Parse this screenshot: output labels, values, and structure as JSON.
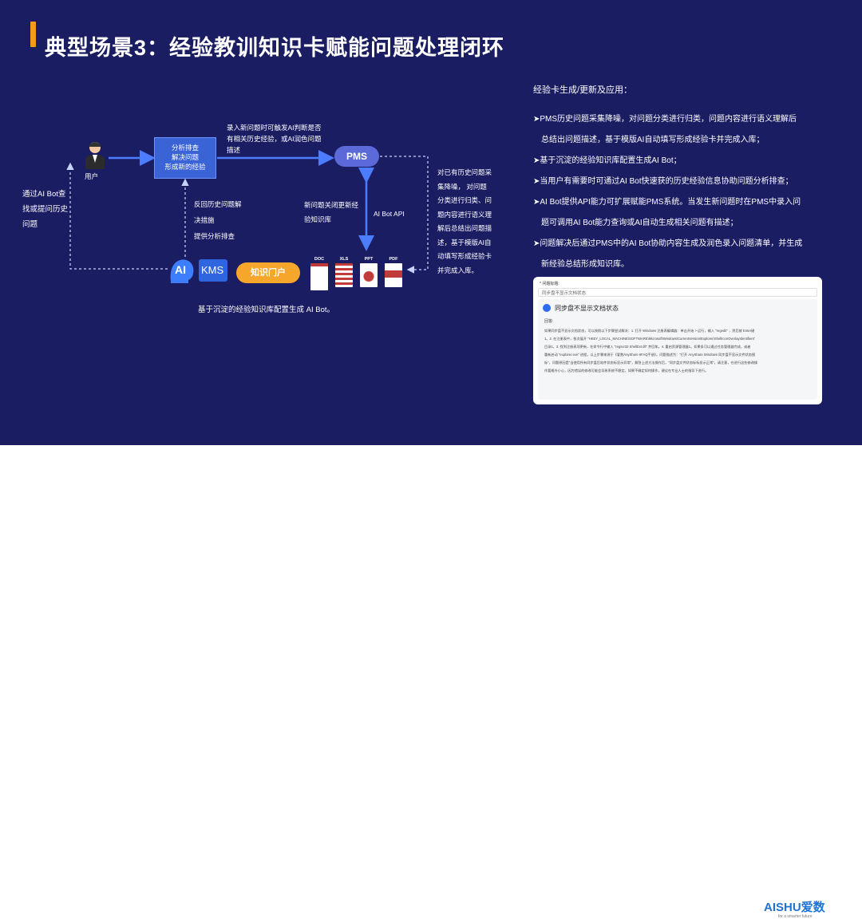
{
  "title": "典型场景3：经验教训知识卡赋能问题处理闭环",
  "diagram": {
    "left_note": [
      "通过AI Bot查",
      "找或提问历史",
      "问题"
    ],
    "user_label": "用户",
    "analysis_box": [
      "分析排查",
      "解决问题",
      "形成新的经验"
    ],
    "top_note": [
      "录入新问题时可触发AI判断是否",
      "有相关历史经验，或AI润色问题",
      "描述"
    ],
    "pms_label": "PMS",
    "feedback_note": [
      "反回历史问题解",
      "决措施",
      "提供分析排查"
    ],
    "close_note": [
      "新问题关闭更新经",
      "验知识库"
    ],
    "api_label": "AI Bot API",
    "right_note": [
      "对已有历史问题采",
      "集降噪，  对问题",
      "分类进行归类、问",
      "题内容进行语义理",
      "解后总结出问题描",
      "述，基于模版AI自",
      "动填写形成经验卡",
      "并完成入库。"
    ],
    "ai_label": "AI",
    "kms_label": "KMS",
    "kb_label": "知识门户",
    "doc_types": [
      "DOC",
      "XLS",
      "PPT",
      "PDF"
    ],
    "bottom_caption": "基于沉淀的经验知识库配置生成 AI Bot。"
  },
  "panel": {
    "title": "经验卡生成/更新及应用：",
    "bullets": [
      [
        "PMS历史问题采集降噪，对问题分类进行归类，问题内容进行语义理解后",
        "总结出问题描述，基于模版AI自动填写形成经验卡并完成入库；"
      ],
      [
        "基于沉淀的经验知识库配置生成AI Bot；"
      ],
      [
        "当用户有需要时可通过AI Bot快速获的历史经验信息协助问题分析排查；"
      ],
      [
        "AI Bot提供API能力可扩展赋能PMS系统。当发生新问题时在PMS中录入问",
        "题可调用AI Bot能力查询或AI自动生成相关问题有描述；"
      ],
      [
        "问题解决后通过PMS中的AI Bot协助内容生成及润色录入问题清单，并生成",
        "新经验总结形成知识库。"
      ]
    ]
  },
  "card": {
    "header": "* 问题标题:",
    "input_value": "同步盘不显示文档状态",
    "question": "同步盘不显示文档状态",
    "answer_label": "回答:",
    "answer_lines": [
      "如果同步盘不显示文档状态，可以按照以下步骤尝试解决：1. 打开 Windows 注册表编辑器：单击开始 > 运行，输入 \"regedit\" ，然后按 Enter键",
      "1。2. 在注册表中，依次展开 \"HKEY_LOCAL_MACHINE\\SOFTWARE\\Microsoft\\Windows\\CurrentVersion\\Explorer\\ShellIconOverlayIdentifiers\"",
      "目录1。3. 找到注册表项更新，在命令行中输入 \"regsvr32 ShellExt.dll\" 并回车。4. 重启资源管理器1。如果条可以通过任务管理器完成，或者",
      "重新启动 \"explorer.exe\" 进程。以上步骤来源于《爱数AnyShare 6FAQ手册》。问题描述为：\"打开 AnyShare Windows 同步盘不显示文件状态图",
      "标\"，问题原因是\"当使用所有同步盘后软件状态标显示异常\"，解答上述方法操作后，\"同步盘文件状态标标显示正常\"。请注意，在进行这些修改操",
      "作要格外小心，因为错误的修改可能会导致系统不稳定。如果不确定如何操作，建议在专业人士的指导下进行。"
    ]
  },
  "footer": {
    "logo": "AISHU爱数",
    "tagline": "for a smarter future"
  },
  "colors": {
    "background": "#1b1d63",
    "accent": "#f39a1e",
    "arrow_blue": "#4c7cff",
    "pms": "#5b6ad8",
    "knowledge_portal": "#f6a62a"
  }
}
